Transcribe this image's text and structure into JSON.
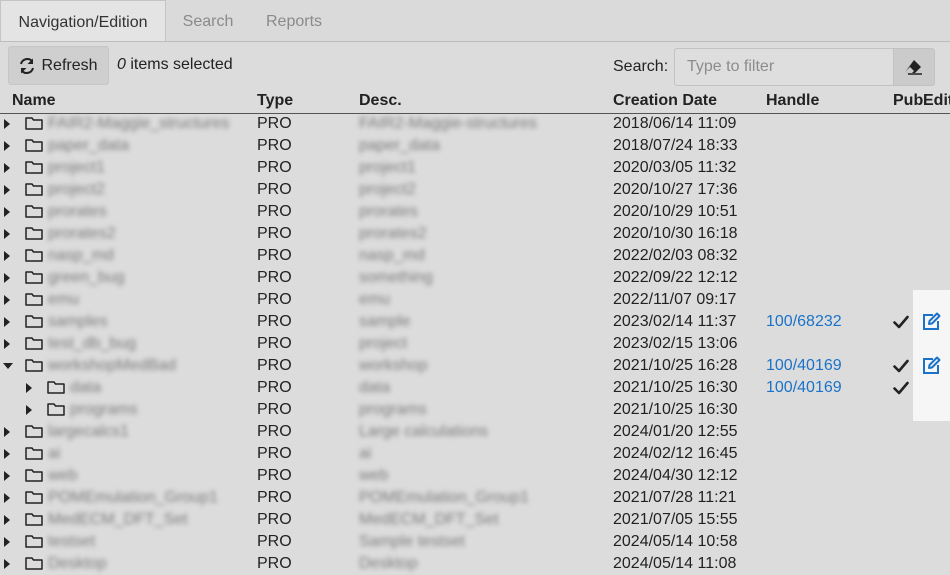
{
  "tabs": [
    {
      "label": "Navigation/Edition"
    },
    {
      "label": "Search"
    },
    {
      "label": "Reports"
    }
  ],
  "toolbar": {
    "refresh_label": "Refresh",
    "selected_count": "0",
    "selected_suffix": " items selected",
    "search_label": "Search:",
    "search_placeholder": "Type to filter"
  },
  "columns": [
    "Name",
    "Type",
    "Desc.",
    "Creation Date",
    "Handle",
    "Pub",
    "Edit"
  ],
  "rows": [
    {
      "expand": "collapsed",
      "depth": 0,
      "name": "FAIR2-Maggie_structures",
      "type": "PRO",
      "desc": "FAIR2-Maggie-structures",
      "date": "2018/06/14 11:09",
      "handle": "",
      "pub": false,
      "edit": false
    },
    {
      "expand": "collapsed",
      "depth": 0,
      "name": "paper_data",
      "type": "PRO",
      "desc": "paper_data",
      "date": "2018/07/24 18:33",
      "handle": "",
      "pub": false,
      "edit": false
    },
    {
      "expand": "collapsed",
      "depth": 0,
      "name": "project1",
      "type": "PRO",
      "desc": "project1",
      "date": "2020/03/05 11:32",
      "handle": "",
      "pub": false,
      "edit": false
    },
    {
      "expand": "collapsed",
      "depth": 0,
      "name": "project2",
      "type": "PRO",
      "desc": "project2",
      "date": "2020/10/27 17:36",
      "handle": "",
      "pub": false,
      "edit": false
    },
    {
      "expand": "collapsed",
      "depth": 0,
      "name": "prorates",
      "type": "PRO",
      "desc": "prorates",
      "date": "2020/10/29 10:51",
      "handle": "",
      "pub": false,
      "edit": false
    },
    {
      "expand": "collapsed",
      "depth": 0,
      "name": "prorates2",
      "type": "PRO",
      "desc": "prorates2",
      "date": "2020/10/30 16:18",
      "handle": "",
      "pub": false,
      "edit": false
    },
    {
      "expand": "collapsed",
      "depth": 0,
      "name": "nasp_md",
      "type": "PRO",
      "desc": "nasp_md",
      "date": "2022/02/03 08:32",
      "handle": "",
      "pub": false,
      "edit": false
    },
    {
      "expand": "collapsed",
      "depth": 0,
      "name": "green_bug",
      "type": "PRO",
      "desc": "something",
      "date": "2022/09/22 12:12",
      "handle": "",
      "pub": false,
      "edit": false
    },
    {
      "expand": "collapsed",
      "depth": 0,
      "name": "emu",
      "type": "PRO",
      "desc": "emu",
      "date": "2022/11/07 09:17",
      "handle": "",
      "pub": false,
      "edit": false
    },
    {
      "expand": "collapsed",
      "depth": 0,
      "name": "samples",
      "type": "PRO",
      "desc": "sample",
      "date": "2023/02/14 11:37",
      "handle": "100/68232",
      "pub": true,
      "edit": true
    },
    {
      "expand": "collapsed",
      "depth": 0,
      "name": "test_db_bug",
      "type": "PRO",
      "desc": "project",
      "date": "2023/02/15 13:06",
      "handle": "",
      "pub": false,
      "edit": false
    },
    {
      "expand": "expanded",
      "depth": 0,
      "name": "workshopMedBad",
      "type": "PRO",
      "desc": "workshop",
      "date": "2021/10/25 16:28",
      "handle": "100/40169",
      "pub": true,
      "edit": true
    },
    {
      "expand": "collapsed",
      "depth": 1,
      "name": "data",
      "type": "PRO",
      "desc": "data",
      "date": "2021/10/25 16:30",
      "handle": "100/40169",
      "pub": true,
      "edit": false
    },
    {
      "expand": "collapsed",
      "depth": 1,
      "name": "programs",
      "type": "PRO",
      "desc": "programs",
      "date": "2021/10/25 16:30",
      "handle": "",
      "pub": false,
      "edit": false
    },
    {
      "expand": "collapsed",
      "depth": 0,
      "name": "largecalcs1",
      "type": "PRO",
      "desc": "Large calculations",
      "date": "2024/01/20 12:55",
      "handle": "",
      "pub": false,
      "edit": false
    },
    {
      "expand": "collapsed",
      "depth": 0,
      "name": "ai",
      "type": "PRO",
      "desc": "ai",
      "date": "2024/02/12 16:45",
      "handle": "",
      "pub": false,
      "edit": false
    },
    {
      "expand": "collapsed",
      "depth": 0,
      "name": "web",
      "type": "PRO",
      "desc": "web",
      "date": "2024/04/30 12:12",
      "handle": "",
      "pub": false,
      "edit": false
    },
    {
      "expand": "collapsed",
      "depth": 0,
      "name": "POMEmulation_Group1",
      "type": "PRO",
      "desc": "POMEmulation_Group1",
      "date": "2021/07/28 11:21",
      "handle": "",
      "pub": false,
      "edit": false
    },
    {
      "expand": "collapsed",
      "depth": 0,
      "name": "MedECM_DFT_Set",
      "type": "PRO",
      "desc": "MedECM_DFT_Set",
      "date": "2021/07/05 15:55",
      "handle": "",
      "pub": false,
      "edit": false
    },
    {
      "expand": "collapsed",
      "depth": 0,
      "name": "testset",
      "type": "PRO",
      "desc": "Sample testset",
      "date": "2024/05/14 10:58",
      "handle": "",
      "pub": false,
      "edit": false
    },
    {
      "expand": "collapsed",
      "depth": 0,
      "name": "Desktop",
      "type": "PRO",
      "desc": "Desktop",
      "date": "2024/05/14 11:08",
      "handle": "",
      "pub": false,
      "edit": false
    }
  ],
  "colors": {
    "background": "#dcdcdc",
    "link": "#1a73c9",
    "text": "#222222"
  },
  "icons": {
    "refresh": "refresh-icon",
    "clear": "eraser-icon",
    "folder": "folder-icon",
    "check": "check-icon",
    "edit": "edit-icon"
  }
}
